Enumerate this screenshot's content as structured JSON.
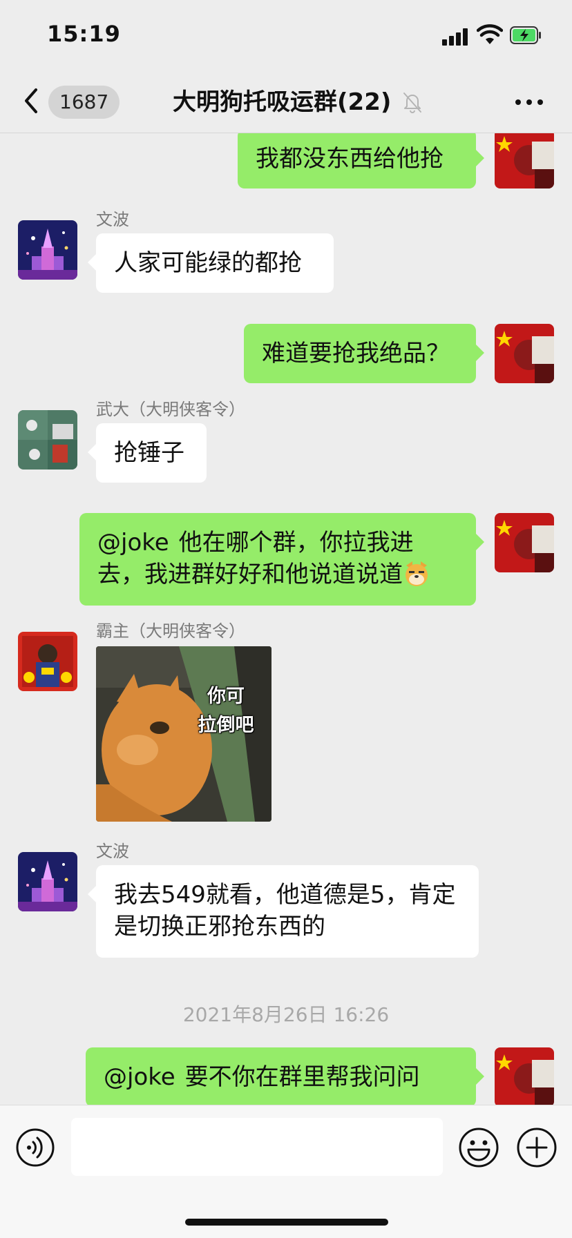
{
  "status_bar": {
    "time": "15:19"
  },
  "header": {
    "back_count": "1687",
    "title": "大明狗托吸运群(22)"
  },
  "messages": [
    {
      "type": "out",
      "text": "我都没东西给他抢"
    },
    {
      "type": "in",
      "sender": "文波",
      "text": "人家可能绿的都抢"
    },
    {
      "type": "out",
      "text": "难道要抢我绝品？"
    },
    {
      "type": "in",
      "sender": "武大（大明侠客令）",
      "text": "抢锤子"
    },
    {
      "type": "out",
      "mention": "@joke",
      "text": "他在哪个群，你拉我进去，我进群好好和他说道说道",
      "emoji": "dog-face-emoji"
    },
    {
      "type": "in-sticker",
      "sender": "霸主（大明侠客令）",
      "sticker_text": [
        "你可",
        "拉倒吧"
      ]
    },
    {
      "type": "in",
      "sender": "文波",
      "text": "我去549就看，他道德是5，肯定是切换正邪抢东西的"
    },
    {
      "type": "time",
      "text": "2021年8月26日 16:26"
    },
    {
      "type": "out",
      "mention": "@joke",
      "text": "要不你在群里帮我问问"
    }
  ],
  "input_bar": {
    "placeholder": ""
  },
  "icons": [
    "back-chevron-icon",
    "mute-bell-icon",
    "more-dots-icon",
    "voice-icon",
    "emoji-icon",
    "plus-icon"
  ],
  "colors": {
    "background": "#ededed",
    "bubble_out": "#95ec69",
    "bubble_in": "#ffffff",
    "timestamp": "#a8a8a8"
  }
}
